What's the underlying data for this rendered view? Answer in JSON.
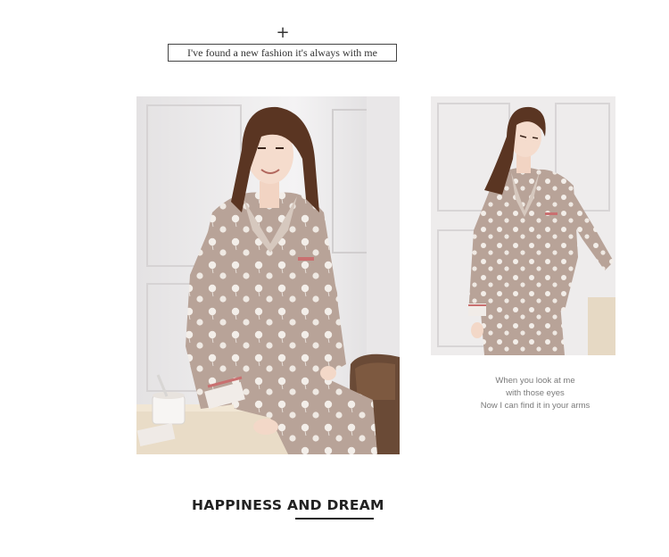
{
  "header": {
    "plus_symbol": "+",
    "tagline": "I've found a new fashion it's always with me"
  },
  "images": {
    "main": {
      "alt": "woman in printed pajamas sitting on dresser",
      "icon": "photo-image"
    },
    "side": {
      "alt": "woman in printed pajamas standing",
      "icon": "photo-image"
    }
  },
  "caption": {
    "lines": [
      "When you look at me",
      "with those eyes",
      "Now I can find it in your arms"
    ]
  },
  "footer": {
    "headline": "HAPPINESS AND DREAM"
  },
  "colors": {
    "background": "#ffffff",
    "fabric": "#b8a398",
    "trim": "#c97070",
    "text_dark": "#222222",
    "text_muted": "#7a7a7a"
  }
}
